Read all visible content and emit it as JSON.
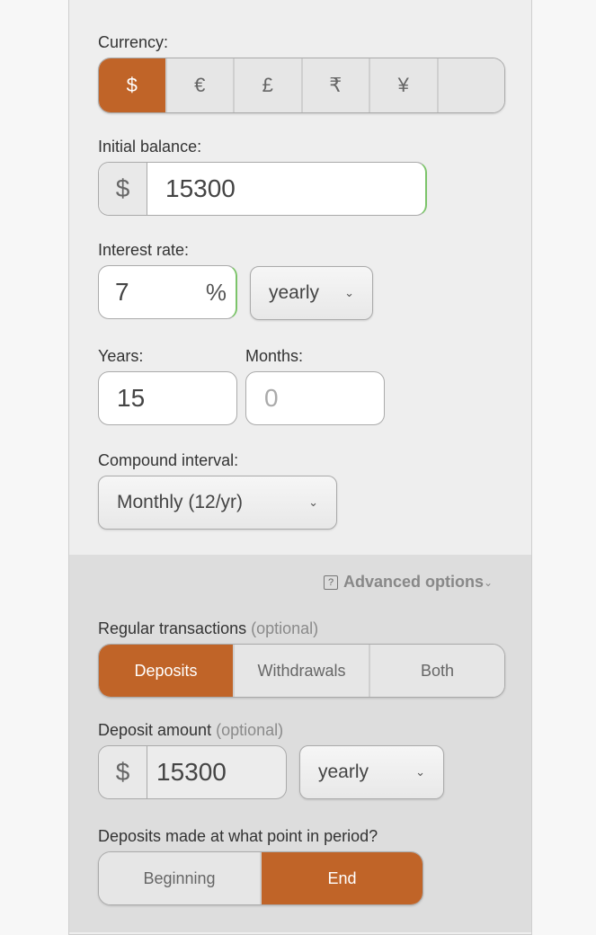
{
  "currency": {
    "label": "Currency:",
    "options": [
      "$",
      "€",
      "£",
      "₹",
      "¥",
      ""
    ],
    "selected": "$"
  },
  "initial_balance": {
    "label": "Initial balance:",
    "prefix": "$",
    "value": "15300"
  },
  "interest_rate": {
    "label": "Interest rate:",
    "value": "7",
    "suffix": "%",
    "period": "yearly"
  },
  "years": {
    "label": "Years:",
    "value": "15"
  },
  "months": {
    "label": "Months:",
    "placeholder": "0"
  },
  "compound_interval": {
    "label": "Compound interval:",
    "selected": "Monthly (12/yr)"
  },
  "advanced_options": {
    "label": "Advanced options",
    "help_icon": "?"
  },
  "regular_transactions": {
    "label": "Regular transactions",
    "optional": "(optional)",
    "options": [
      "Deposits",
      "Withdrawals",
      "Both"
    ],
    "selected": "Deposits"
  },
  "deposit_amount": {
    "label": "Deposit amount",
    "optional": "(optional)",
    "prefix": "$",
    "value": "15300",
    "period": "yearly"
  },
  "deposit_timing": {
    "label": "Deposits made at what point in period?",
    "options": [
      "Beginning",
      "End"
    ],
    "selected": "End"
  },
  "colors": {
    "accent": "#c06428"
  }
}
